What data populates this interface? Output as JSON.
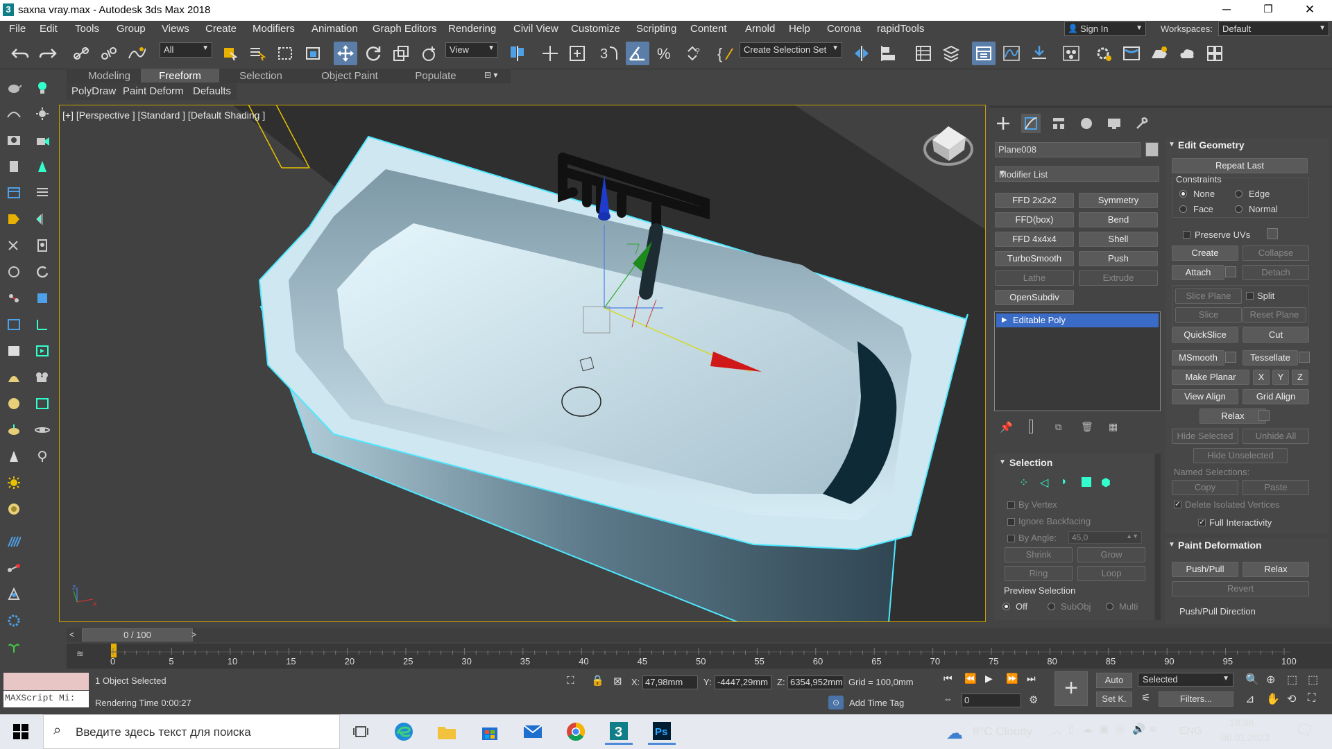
{
  "window": {
    "title": "saxna vray.max - Autodesk 3ds Max 2018",
    "app_icon": "3",
    "minimize": "─",
    "maximize": "❐",
    "close": "✕"
  },
  "menu": [
    "File",
    "Edit",
    "Tools",
    "Group",
    "Views",
    "Create",
    "Modifiers",
    "Animation",
    "Graph Editors",
    "Rendering",
    "Civil View",
    "Customize",
    "Scripting",
    "Content",
    "Arnold",
    "Help",
    "Corona",
    "rapidTools"
  ],
  "signin": "Sign In",
  "workspaces": {
    "label": "Workspaces:",
    "value": "Default"
  },
  "toolbar": {
    "filter": "All",
    "refcoord": "View",
    "selection_set": "Create Selection Set"
  },
  "ribbon": {
    "tabs": [
      "Modeling",
      "Freeform",
      "Selection",
      "Object Paint",
      "Populate"
    ],
    "active": "Freeform",
    "subtabs": [
      "PolyDraw",
      "Paint Deform",
      "Defaults"
    ]
  },
  "viewport": {
    "label": "[+] [Perspective ] [Standard ] [Default Shading ]"
  },
  "command_panel": {
    "object_name": "Plane008",
    "modifier_list": "Modifier List",
    "modifier_buttons": [
      {
        "label": "FFD 2x2x2",
        "enabled": true
      },
      {
        "label": "Symmetry",
        "enabled": true
      },
      {
        "label": "FFD(box)",
        "enabled": true
      },
      {
        "label": "Bend",
        "enabled": true
      },
      {
        "label": "FFD 4x4x4",
        "enabled": true
      },
      {
        "label": "Shell",
        "enabled": true
      },
      {
        "label": "TurboSmooth",
        "enabled": true
      },
      {
        "label": "Push",
        "enabled": true
      },
      {
        "label": "Lathe",
        "enabled": false
      },
      {
        "label": "Extrude",
        "enabled": false
      },
      {
        "label": "OpenSubdiv",
        "enabled": true
      }
    ],
    "stack": [
      "Editable Poly"
    ],
    "selection": {
      "title": "Selection",
      "by_vertex": "By Vertex",
      "ignore_backfacing": "Ignore Backfacing",
      "by_angle": "By Angle:",
      "angle_value": "45,0",
      "shrink": "Shrink",
      "grow": "Grow",
      "ring": "Ring",
      "loop": "Loop",
      "preview_title": "Preview Selection",
      "preview_options": [
        "Off",
        "SubObj",
        "Multi"
      ]
    },
    "edit_geometry": {
      "title": "Edit Geometry",
      "repeat_last": "Repeat Last",
      "constraints_title": "Constraints",
      "constraints": [
        "None",
        "Edge",
        "Face",
        "Normal"
      ],
      "preserve_uvs": "Preserve UVs",
      "create": "Create",
      "collapse": "Collapse",
      "attach": "Attach",
      "detach": "Detach",
      "slice_plane": "Slice Plane",
      "split": "Split",
      "slice": "Slice",
      "reset_plane": "Reset Plane",
      "quickslice": "QuickSlice",
      "cut": "Cut",
      "msmooth": "MSmooth",
      "tessellate": "Tessellate",
      "make_planar": "Make Planar",
      "x": "X",
      "y": "Y",
      "z": "Z",
      "view_align": "View Align",
      "grid_align": "Grid Align",
      "relax": "Relax",
      "hide_selected": "Hide Selected",
      "unhide_all": "Unhide All",
      "hide_unselected": "Hide Unselected",
      "named_selections": "Named Selections:",
      "copy": "Copy",
      "paste": "Paste",
      "delete_isolated": "Delete Isolated Vertices",
      "full_interactivity": "Full Interactivity"
    },
    "paint_deformation": {
      "title": "Paint Deformation",
      "push_pull": "Push/Pull",
      "relax": "Relax",
      "revert": "Revert",
      "direction": "Push/Pull Direction"
    }
  },
  "timeline": {
    "slider": "0 / 100",
    "ticks": [
      "0",
      "5",
      "10",
      "15",
      "20",
      "25",
      "30",
      "35",
      "40",
      "45",
      "50",
      "55",
      "60",
      "65",
      "70",
      "75",
      "80",
      "85",
      "90",
      "95",
      "100"
    ]
  },
  "status": {
    "maxscript": "MAXScript Mi:",
    "selected": "1 Object Selected",
    "render_time": "Rendering Time  0:00:27",
    "x_label": "X:",
    "x": "47,98mm",
    "y_label": "Y:",
    "y": "-4447,29mm",
    "z_label": "Z:",
    "z": "6354,952mm",
    "grid": "Grid = 100,0mm",
    "add_time_tag": "Add Time Tag",
    "auto": "Auto",
    "set_key": "Set K.",
    "selected_dropdown": "Selected",
    "filters": "Filters...",
    "frame": "0"
  },
  "taskbar": {
    "search_placeholder": "Введите здесь текст для поиска",
    "weather": "8°C  Cloudy",
    "lang": "ENG",
    "time": "18:36",
    "date": "06.01.2023"
  }
}
